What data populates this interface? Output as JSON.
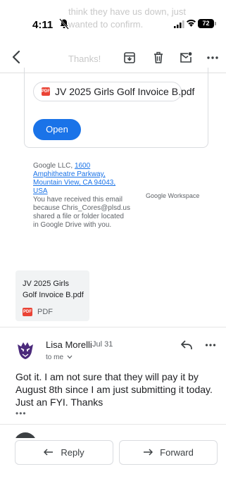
{
  "status_bar": {
    "time": "4:11",
    "battery": "72"
  },
  "ghost_text": {
    "line1": "think they have us down, just",
    "line2": "wanted to confirm.",
    "line3": "Thanks!"
  },
  "toolbar": {
    "back_icon": "chevron-left-icon",
    "icons": [
      "archive-icon",
      "trash-icon",
      "mark-unread-icon",
      "more-horizontal-icon"
    ]
  },
  "shared_card": {
    "file_name": "JV 2025 Girls Golf Invoice B.pdf",
    "file_badge": "PDF",
    "open_label": "Open"
  },
  "footer": {
    "company": "Google LLC,",
    "address_line1": "1600",
    "address_line2": "Amphitheatre Parkway,",
    "address_line3": "Mountain View, CA 94043,",
    "address_line4": "USA",
    "notice_line1": "You have received this email",
    "notice_line2": "because Chris_Cores@plsd.us",
    "notice_line3": "shared a file or folder located",
    "notice_line4": "in Google Drive with you.",
    "brand": "Google Workspace"
  },
  "attachment": {
    "title_line1": "JV 2025 Girls",
    "title_line2": "Golf Invoice B.pdf",
    "badge": "PDF",
    "type": "PDF"
  },
  "message": {
    "sender": "Lisa Morelli",
    "date": "Jul 31",
    "to": "to me",
    "body": "Got it. I am not sure that they will pay it by August 8th since I am just submitting it today. Just an FYI. Thanks",
    "ellipsis": "•••"
  },
  "actions": {
    "reply": "Reply",
    "forward": "Forward"
  },
  "colors": {
    "accent": "#1a73e8",
    "pdf_red": "#ea4335",
    "avatar_purple": "#4b2a7b"
  }
}
